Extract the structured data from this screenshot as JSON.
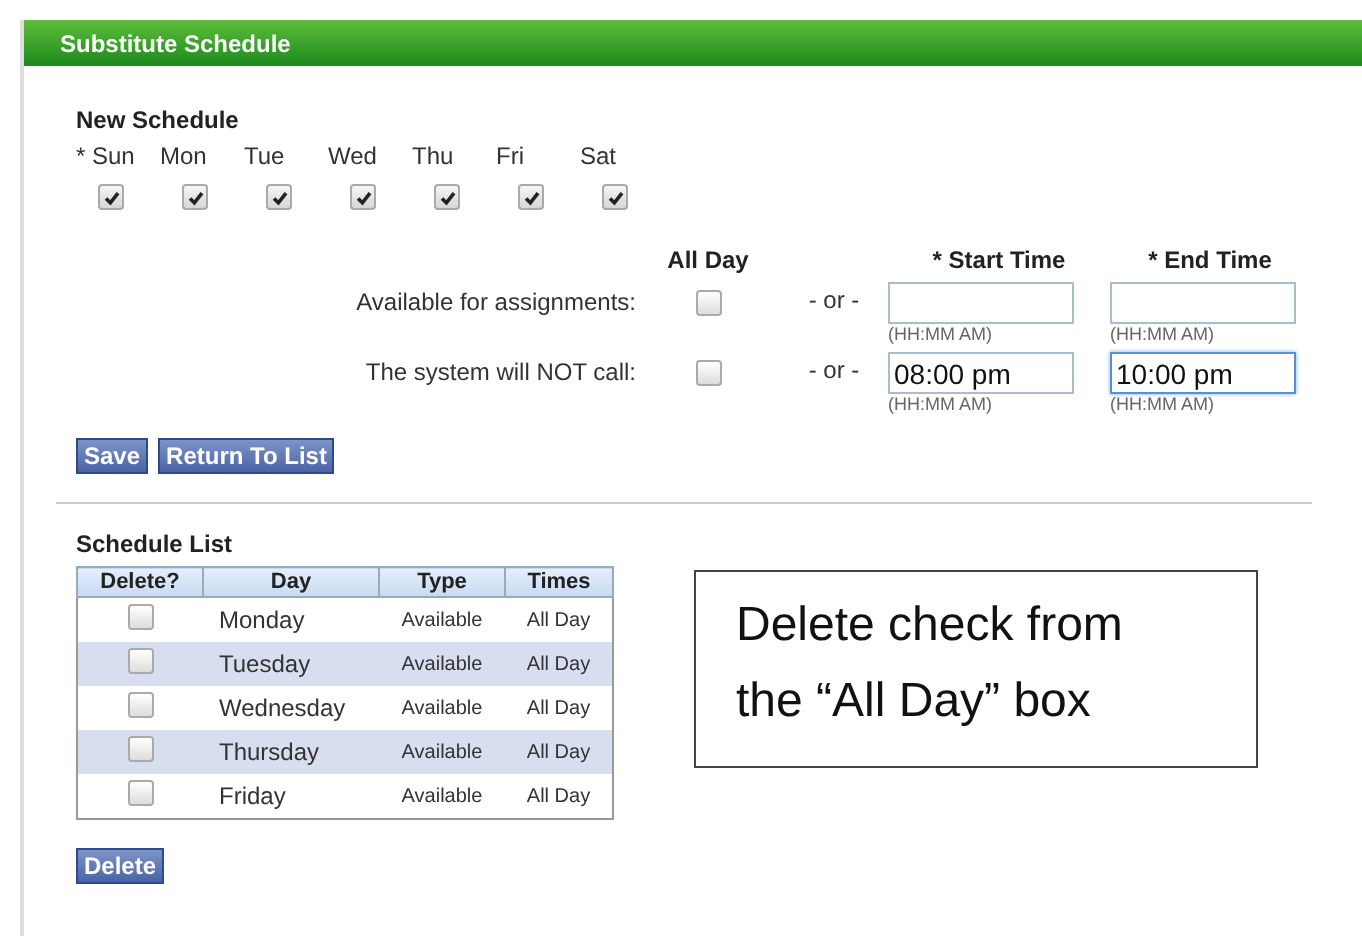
{
  "header": {
    "title": "Substitute Schedule"
  },
  "new_schedule": {
    "heading": "New Schedule",
    "days": [
      {
        "label": "* Sun",
        "checked": true
      },
      {
        "label": "Mon",
        "checked": true
      },
      {
        "label": "Tue",
        "checked": true
      },
      {
        "label": "Wed",
        "checked": true
      },
      {
        "label": "Thu",
        "checked": true
      },
      {
        "label": "Fri",
        "checked": true
      },
      {
        "label": "Sat",
        "checked": true
      }
    ],
    "columns": {
      "all_day": "All Day",
      "start_time": "* Start Time",
      "end_time": "* End Time"
    },
    "rows": [
      {
        "label": "Available for assignments:",
        "all_day": false,
        "separator": "- or -",
        "start": {
          "hint": "(HH:MM AM)"
        },
        "end": {
          "hint": "(HH:MM AM)",
          "focused": false
        }
      },
      {
        "label": "The system will NOT call:",
        "all_day": false,
        "separator": "- or -",
        "start": {
          "value": "08:00 pm",
          "hint": "(HH:MM AM)"
        },
        "end": {
          "value": "10:00 pm",
          "hint": "(HH:MM AM)",
          "focused": true
        }
      }
    ],
    "buttons": [
      "Save",
      "Return To List"
    ]
  },
  "schedule_list": {
    "heading": "Schedule List",
    "columns": [
      "Delete?",
      "Day",
      "Type",
      "Times"
    ],
    "rows": [
      {
        "delete": false,
        "day": "Monday",
        "type": "Available",
        "times": "All Day"
      },
      {
        "delete": false,
        "day": "Tuesday",
        "type": "Available",
        "times": "All Day"
      },
      {
        "delete": false,
        "day": "Wednesday",
        "type": "Available",
        "times": "All Day"
      },
      {
        "delete": false,
        "day": "Thursday",
        "type": "Available",
        "times": "All Day"
      },
      {
        "delete": false,
        "day": "Friday",
        "type": "Available",
        "times": "All Day"
      }
    ],
    "button": "Delete"
  },
  "note": {
    "text": "Delete check from the “All Day” box"
  }
}
